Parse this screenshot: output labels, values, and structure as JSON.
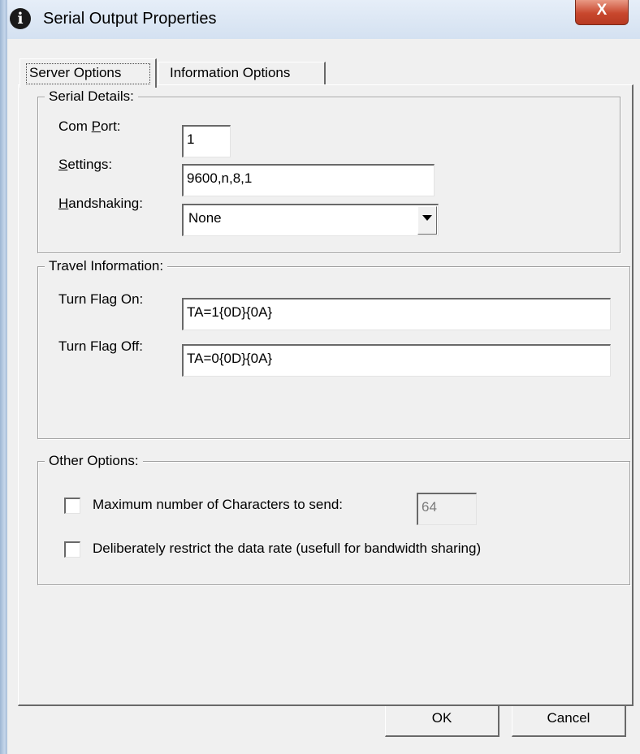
{
  "window": {
    "title": "Serial Output Properties",
    "title_icon": "info-icon",
    "close_glyph": "X",
    "close_icon": "close-icon"
  },
  "tabs": [
    {
      "label": "Server Options",
      "active": true
    },
    {
      "label": "Information Options",
      "active": false
    }
  ],
  "serial_details": {
    "legend": "Serial Details:",
    "com_port": {
      "label_mn": "P",
      "label_pre": "Com ",
      "label_post": "ort:",
      "value": "1"
    },
    "settings": {
      "label_mn": "S",
      "label_pre": "",
      "label_post": "ettings:",
      "value": "9600,n,8,1"
    },
    "handshaking": {
      "label_mn": "H",
      "label_pre": "",
      "label_post": "andshaking:",
      "value": "None",
      "arrow_icon": "chevron-down-icon"
    }
  },
  "travel_information": {
    "legend": "Travel Information:",
    "flag_on": {
      "label": "Turn Flag On:",
      "value": "TA=1{0D}{0A}"
    },
    "flag_off": {
      "label": "Turn Flag Off:",
      "value": "TA=0{0D}{0A}"
    }
  },
  "other_options": {
    "legend": "Other Options:",
    "max_chars": {
      "label": "Maximum number of Characters to send:",
      "checked": false,
      "value": "64"
    },
    "restrict_rate": {
      "label": "Deliberately restrict the data rate (usefull for bandwidth sharing)",
      "checked": false
    }
  },
  "buttons": {
    "ok": "OK",
    "cancel": "Cancel"
  },
  "colors": {
    "close_button": "#c8472d",
    "window_frame": "#b9cde5",
    "face": "#f0f0f0"
  }
}
